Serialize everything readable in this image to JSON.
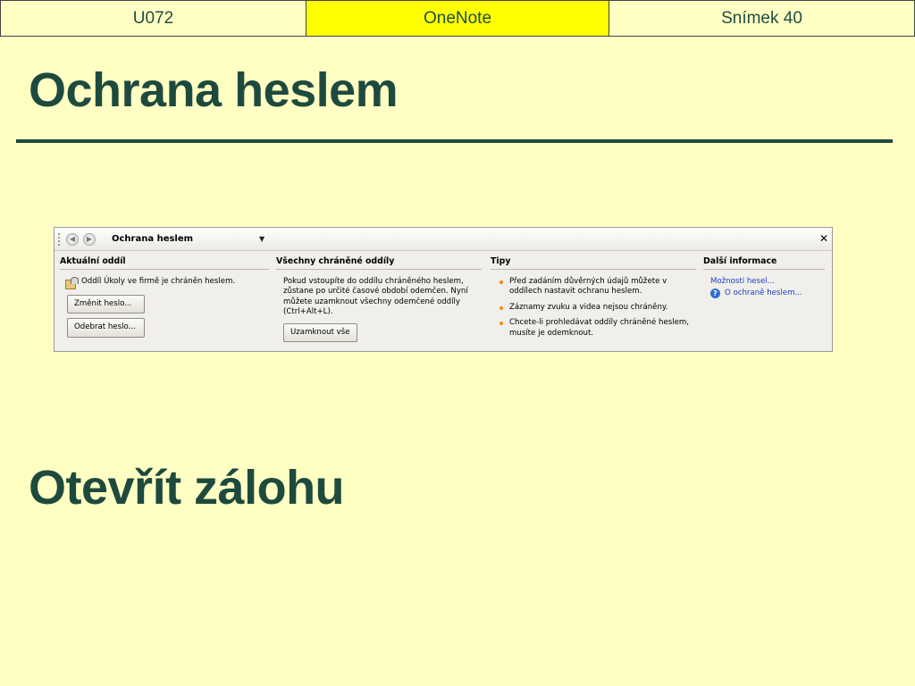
{
  "header": {
    "course": "U072",
    "app": "OneNote",
    "slide": "Snímek 40"
  },
  "headings": {
    "first": "Ochrana heslem",
    "second": "Otevřít zálohu"
  },
  "pane": {
    "title": "Ochrana heslem",
    "current_section": {
      "heading": "Aktuální oddíl",
      "status": "Oddíl Úkoly ve firmě je chráněn heslem.",
      "change_button": "Změnit heslo...",
      "remove_button": "Odebrat heslo..."
    },
    "all_sections": {
      "heading": "Všechny chráněné oddíly",
      "description": "Pokud vstoupíte do oddílu chráněného heslem, zůstane po určité časové období odemčen. Nyní můžete uzamknout všechny odemčené oddíly (Ctrl+Alt+L).",
      "lock_button": "Uzamknout vše"
    },
    "tips": {
      "heading": "Tipy",
      "items": [
        "Před zadáním důvěrných údajů můžete v oddílech nastavit ochranu heslem.",
        "Záznamy zvuku a videa nejsou chráněny.",
        "Chcete-li prohledávat oddíly chráněné heslem, musíte je odemknout."
      ]
    },
    "more_info": {
      "heading": "Další informace",
      "options_link": "Možnosti hesel...",
      "about_link": "O ochraně heslem..."
    }
  },
  "colors": {
    "background": "#ffffc4",
    "highlight": "#ffff00",
    "heading": "#1e4a3e",
    "link": "#1f3fbf",
    "bullet": "#f08c00"
  }
}
